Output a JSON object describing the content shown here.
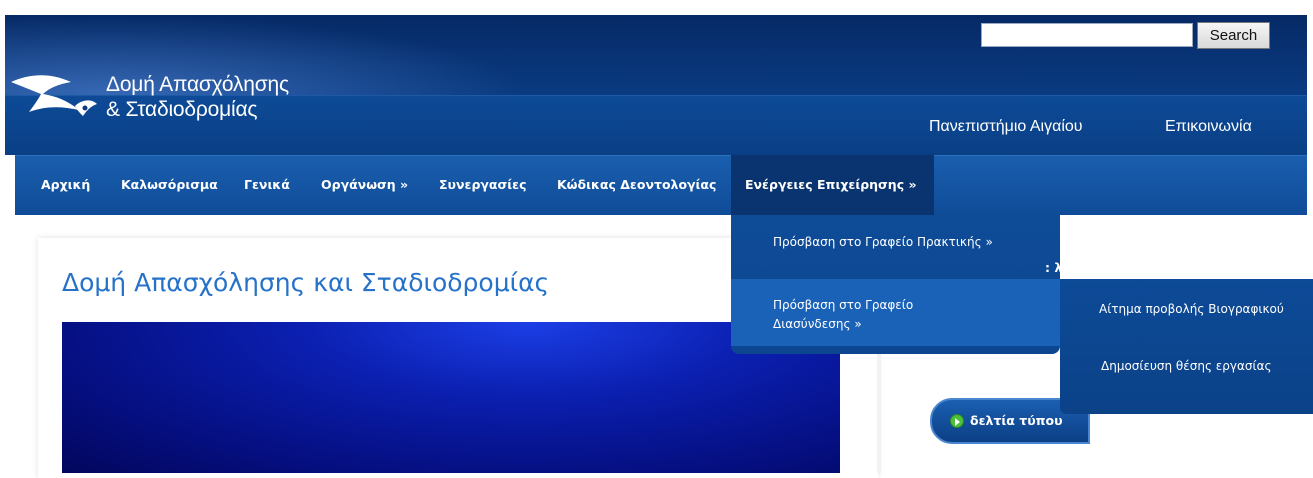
{
  "header": {
    "logo_line1": "Δομή Απασχόλησης",
    "logo_line2": "& Σταδιοδρομίας",
    "search_value": "",
    "search_button": "Search",
    "top_links": [
      "Πανεπιστήμιο Αιγαίου",
      "Επικοινωνία"
    ]
  },
  "nav": {
    "items": [
      "Αρχική",
      "Καλωσόρισμα",
      "Γενικά",
      "Οργάνωση »",
      "Συνεργασίες",
      "Κώδικας Δεοντολογίας",
      "Ενέργειες Επιχείρησης »"
    ]
  },
  "dropdown": {
    "items": [
      "Πρόσβαση στο Γραφείο Πρακτικής »",
      "Πρόσβαση στο Γραφείο Διασύνδεσης »"
    ],
    "item2_line1": "Πρόσβαση στο Γραφείο",
    "item2_line2": "Διασύνδεσης »"
  },
  "subdropdown": {
    "items": [
      "Αίτημα προβολής Βιογραφικού",
      "Δημοσίευση θέσης εργασίας"
    ]
  },
  "main": {
    "title": "Δομή Απασχόλησης και Σταδιοδρομίας"
  },
  "sidebar": {
    "partial_title": ": λογοτύπων δαστα",
    "press_label": "δελτία τύπου"
  },
  "colors": {
    "header_dark": "#062a66",
    "nav_blue": "#1a5eae",
    "nav_active": "#0a3470",
    "title_blue": "#2672c8"
  }
}
